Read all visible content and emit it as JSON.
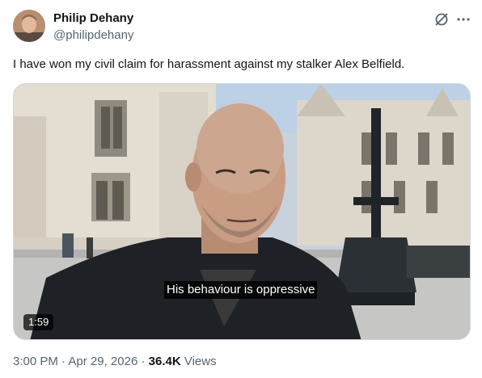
{
  "author": {
    "name": "Philip Dehany",
    "handle": "@philipdehany"
  },
  "tweet": {
    "text": "I have won my civil claim for harassment against my stalker Alex Belfield."
  },
  "video": {
    "caption": "His behaviour is oppressive",
    "duration": "1:59"
  },
  "meta": {
    "time": "3:00 PM",
    "separator": " · ",
    "date": "Apr 29, 2026",
    "views_count": "36.4K",
    "views_label": "Views"
  },
  "icons": {
    "grok": "grok-icon",
    "more": "more-icon"
  },
  "colors": {
    "text": "#0f1419",
    "secondary": "#536471",
    "border": "#cfd9de"
  }
}
